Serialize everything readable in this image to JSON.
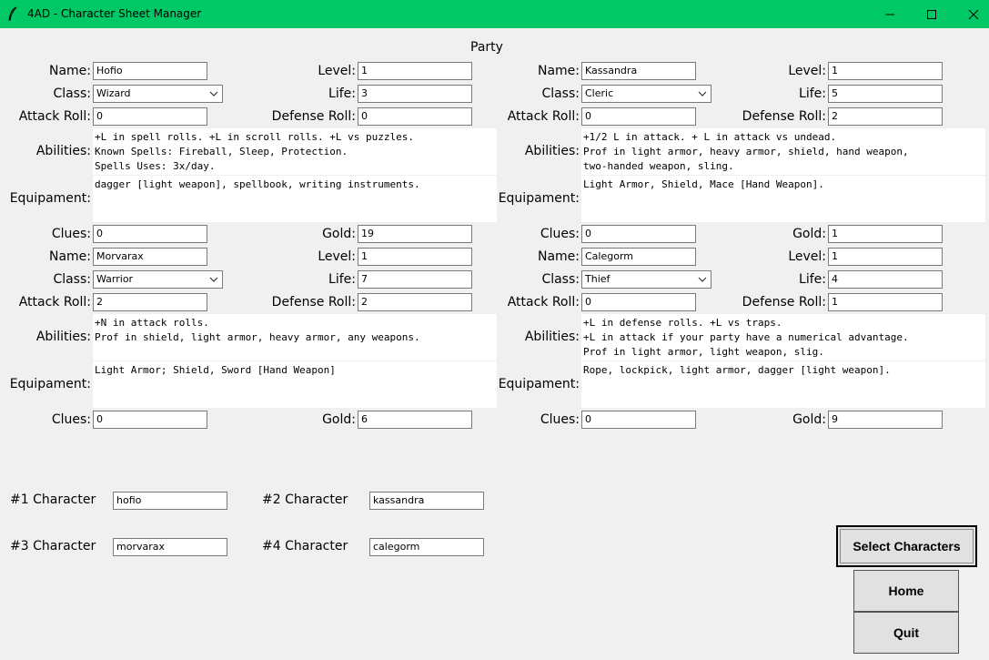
{
  "window": {
    "title": "4AD - Character Sheet Manager",
    "icon": "feather-icon",
    "accent": "#00c864"
  },
  "party_title": "Party",
  "labels": {
    "name": "Name:",
    "class": "Class:",
    "attack": "Attack Roll:",
    "abilities": "Abilities:",
    "equipment": "Equipament:",
    "clues": "Clues:",
    "level": "Level:",
    "life": "Life:",
    "defense": "Defense Roll:",
    "gold": "Gold:"
  },
  "characters": [
    {
      "name": "Hofio",
      "class": "Wizard",
      "attack": "0",
      "level": "1",
      "life": "3",
      "defense": "0",
      "abilities": "+L in spell rolls. +L in scroll rolls. +L vs puzzles.\nKnown Spells: Fireball, Sleep, Protection.\nSpells Uses: 3x/day.",
      "equipment": "dagger [light weapon], spellbook, writing instruments.",
      "clues": "0",
      "gold": "19"
    },
    {
      "name": "Kassandra",
      "class": "Cleric",
      "attack": "0",
      "level": "1",
      "life": "5",
      "defense": "2",
      "abilities": "+1/2 L in attack. + L in attack vs undead.\nProf in light armor, heavy armor, shield, hand weapon,\ntwo-handed weapon, sling.",
      "equipment": "Light Armor, Shield, Mace [Hand Weapon].",
      "clues": "0",
      "gold": "1"
    },
    {
      "name": "Morvarax",
      "class": "Warrior",
      "attack": "2",
      "level": "1",
      "life": "7",
      "defense": "2",
      "abilities": "+N in attack rolls.\nProf in shield, light armor, heavy armor, any weapons.",
      "equipment": "Light Armor; Shield, Sword [Hand Weapon]",
      "clues": "0",
      "gold": "6"
    },
    {
      "name": "Calegorm",
      "class": "Thief",
      "attack": "0",
      "level": "1",
      "life": "4",
      "defense": "1",
      "abilities": "+L in defense rolls. +L vs traps.\n+L in attack if your party have a numerical advantage.\nProf in light armor, light weapon, slig.",
      "equipment": "Rope, lockpick, light armor, dagger [light weapon].",
      "clues": "0",
      "gold": "9"
    }
  ],
  "selection": [
    {
      "label": "#1 Character",
      "value": "hofio"
    },
    {
      "label": "#2 Character",
      "value": "kassandra"
    },
    {
      "label": "#3 Character",
      "value": "morvarax"
    },
    {
      "label": "#4 Character",
      "value": "calegorm"
    }
  ],
  "buttons": {
    "select": "Select Characters",
    "home": "Home",
    "quit": "Quit"
  }
}
